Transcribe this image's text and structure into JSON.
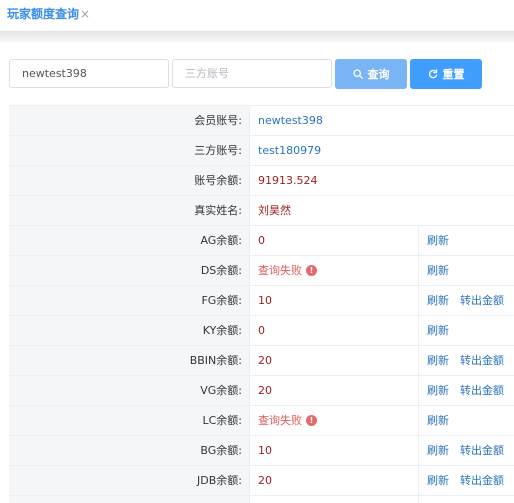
{
  "tab": {
    "title": "玩家额度查询",
    "close": "×"
  },
  "search": {
    "account_value": "newtest398",
    "third_placeholder": "三方账号",
    "query_label": "查询",
    "reset_label": "重置"
  },
  "info_rows": [
    {
      "label": "会员账号:",
      "value": "newtest398"
    },
    {
      "label": "三方账号:",
      "value": "test180979"
    },
    {
      "label": "账号余额:",
      "value": "91913.524"
    },
    {
      "label": "真实姓名:",
      "value": "刘昊然"
    }
  ],
  "balance_rows": [
    {
      "label": "AG余额:",
      "value": "0",
      "refresh": "刷新"
    },
    {
      "label": "DS余额:",
      "value": "查询失败",
      "refresh": "刷新"
    },
    {
      "label": "FG余额:",
      "value": "10",
      "refresh": "刷新",
      "transfer": "转出金额"
    },
    {
      "label": "KY余额:",
      "value": "0",
      "refresh": "刷新"
    },
    {
      "label": "BBIN余额:",
      "value": "20",
      "refresh": "刷新",
      "transfer": "转出金额"
    },
    {
      "label": "VG余额:",
      "value": "20",
      "refresh": "刷新",
      "transfer": "转出金额"
    },
    {
      "label": "LC余额:",
      "value": "查询失败",
      "refresh": "刷新"
    },
    {
      "label": "BG余额:",
      "value": "10",
      "refresh": "刷新",
      "transfer": "转出金额"
    },
    {
      "label": "JDB余额:",
      "value": "20",
      "refresh": "刷新",
      "transfer": "转出金额"
    }
  ],
  "error_icon": "!",
  "colors": {
    "primary": "#409eff",
    "link": "#2a73bc",
    "value_red": "#9b1c1c",
    "error": "#e05b5b"
  }
}
